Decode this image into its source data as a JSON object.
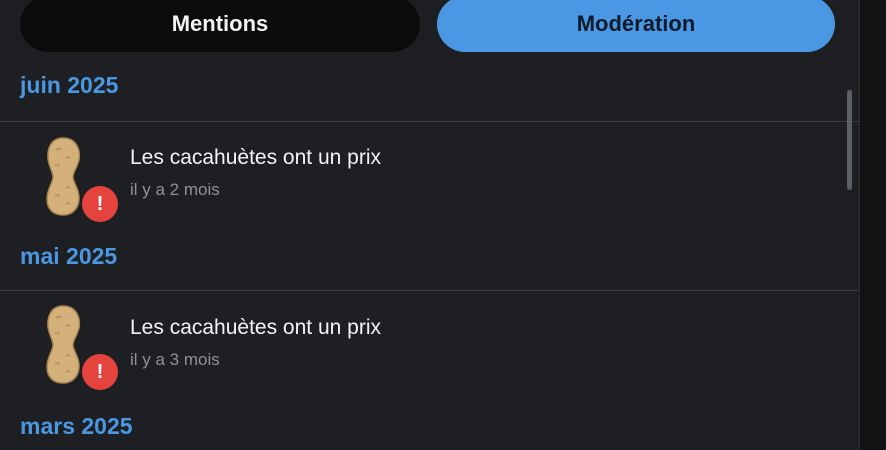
{
  "tabs": [
    {
      "label": "Mentions",
      "active": false
    },
    {
      "label": "Modération",
      "active": true
    }
  ],
  "groups": [
    {
      "month": "juin 2025",
      "items": [
        {
          "title": "Les cacahuètes ont un prix",
          "time": "il y a 2 mois",
          "badge": "!"
        }
      ]
    },
    {
      "month": "mai 2025",
      "items": [
        {
          "title": "Les cacahuètes ont un prix",
          "time": "il y a 3 mois",
          "badge": "!"
        }
      ]
    },
    {
      "month": "mars 2025",
      "items": []
    }
  ],
  "icons": {
    "avatar": "peanut-icon",
    "badge": "alert-icon"
  },
  "colors": {
    "accent": "#4a98e4",
    "background": "#1e1f22",
    "badge": "#e5443e",
    "inactive_tab": "#0b0b0c"
  }
}
